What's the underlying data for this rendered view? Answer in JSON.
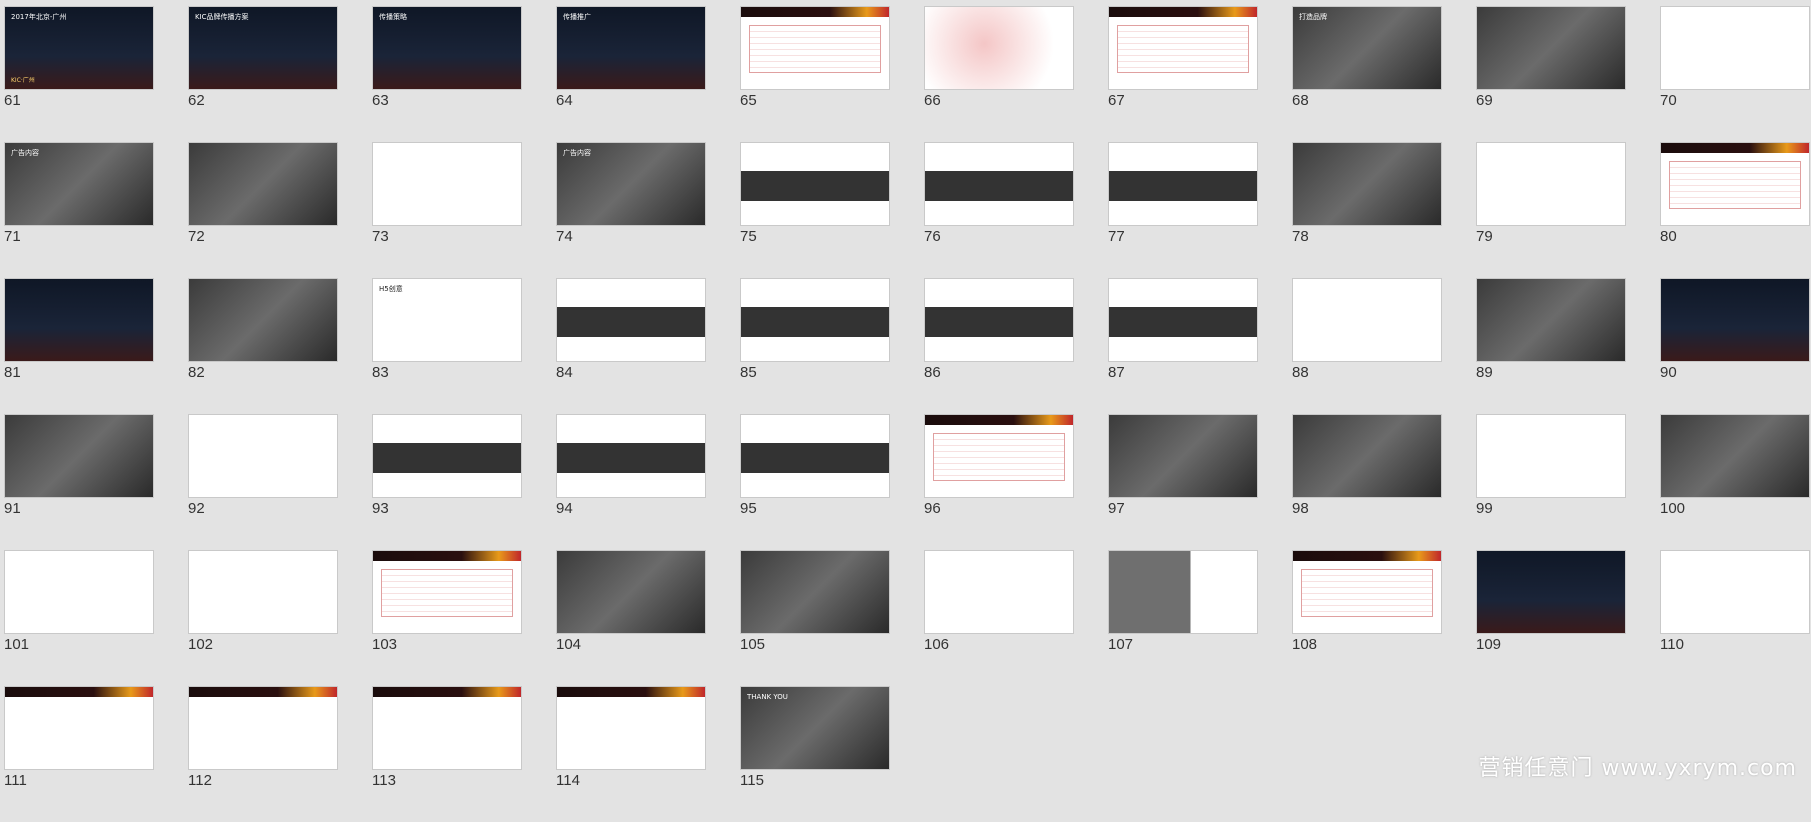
{
  "watermark": "营销任意门 www.yxrym.com",
  "slides": [
    {
      "n": "61",
      "style": "dark",
      "title": "2017年北京-广州",
      "sub": "KIC·广州"
    },
    {
      "n": "62",
      "style": "dark",
      "title": "KIC品牌传播方案",
      "sub": ""
    },
    {
      "n": "63",
      "style": "dark",
      "title": "传播策略",
      "sub": ""
    },
    {
      "n": "64",
      "style": "dark",
      "title": "传播推广",
      "sub": ""
    },
    {
      "n": "65",
      "style": "table",
      "title": "",
      "sub": ""
    },
    {
      "n": "66",
      "style": "map",
      "title": "",
      "sub": ""
    },
    {
      "n": "67",
      "style": "table",
      "title": "",
      "sub": ""
    },
    {
      "n": "68",
      "style": "photo",
      "title": "打造品牌",
      "sub": ""
    },
    {
      "n": "69",
      "style": "photo",
      "title": "",
      "sub": ""
    },
    {
      "n": "70",
      "style": "white",
      "title": "",
      "sub": ""
    },
    {
      "n": "71",
      "style": "photo",
      "title": "广告内容",
      "sub": ""
    },
    {
      "n": "72",
      "style": "photo",
      "title": "",
      "sub": ""
    },
    {
      "n": "73",
      "style": "white",
      "title": "",
      "sub": ""
    },
    {
      "n": "74",
      "style": "photo",
      "title": "广告内容",
      "sub": ""
    },
    {
      "n": "75",
      "style": "panel",
      "title": "",
      "sub": ""
    },
    {
      "n": "76",
      "style": "panel",
      "title": "",
      "sub": ""
    },
    {
      "n": "77",
      "style": "panel",
      "title": "",
      "sub": ""
    },
    {
      "n": "78",
      "style": "photo",
      "title": "",
      "sub": ""
    },
    {
      "n": "79",
      "style": "white",
      "title": "",
      "sub": ""
    },
    {
      "n": "80",
      "style": "table",
      "title": "",
      "sub": ""
    },
    {
      "n": "81",
      "style": "dark",
      "title": "",
      "sub": ""
    },
    {
      "n": "82",
      "style": "photo",
      "title": "",
      "sub": ""
    },
    {
      "n": "83",
      "style": "white",
      "title": "H5创意",
      "sub": ""
    },
    {
      "n": "84",
      "style": "panel",
      "title": "",
      "sub": ""
    },
    {
      "n": "85",
      "style": "panel",
      "title": "",
      "sub": ""
    },
    {
      "n": "86",
      "style": "panel",
      "title": "",
      "sub": ""
    },
    {
      "n": "87",
      "style": "panel",
      "title": "",
      "sub": ""
    },
    {
      "n": "88",
      "style": "white",
      "title": "",
      "sub": ""
    },
    {
      "n": "89",
      "style": "photo",
      "title": "",
      "sub": ""
    },
    {
      "n": "90",
      "style": "dark",
      "title": "",
      "sub": ""
    },
    {
      "n": "91",
      "style": "photo",
      "title": "",
      "sub": ""
    },
    {
      "n": "92",
      "style": "white",
      "title": "",
      "sub": ""
    },
    {
      "n": "93",
      "style": "panel",
      "title": "",
      "sub": ""
    },
    {
      "n": "94",
      "style": "panel",
      "title": "",
      "sub": ""
    },
    {
      "n": "95",
      "style": "panel",
      "title": "",
      "sub": ""
    },
    {
      "n": "96",
      "style": "table",
      "title": "",
      "sub": ""
    },
    {
      "n": "97",
      "style": "photo",
      "title": "",
      "sub": ""
    },
    {
      "n": "98",
      "style": "photo",
      "title": "",
      "sub": ""
    },
    {
      "n": "99",
      "style": "white",
      "title": "",
      "sub": ""
    },
    {
      "n": "100",
      "style": "photo",
      "title": "",
      "sub": ""
    },
    {
      "n": "101",
      "style": "white",
      "title": "",
      "sub": ""
    },
    {
      "n": "102",
      "style": "white",
      "title": "",
      "sub": ""
    },
    {
      "n": "103",
      "style": "table",
      "title": "",
      "sub": ""
    },
    {
      "n": "104",
      "style": "photo",
      "title": "",
      "sub": ""
    },
    {
      "n": "105",
      "style": "photo",
      "title": "",
      "sub": ""
    },
    {
      "n": "106",
      "style": "white",
      "title": "",
      "sub": ""
    },
    {
      "n": "107",
      "style": "gray",
      "title": "",
      "sub": ""
    },
    {
      "n": "108",
      "style": "table",
      "title": "",
      "sub": ""
    },
    {
      "n": "109",
      "style": "dark",
      "title": "",
      "sub": ""
    },
    {
      "n": "110",
      "style": "white",
      "title": "",
      "sub": ""
    },
    {
      "n": "111",
      "style": "bar",
      "title": "",
      "sub": ""
    },
    {
      "n": "112",
      "style": "bar",
      "title": "",
      "sub": ""
    },
    {
      "n": "113",
      "style": "bar",
      "title": "",
      "sub": ""
    },
    {
      "n": "114",
      "style": "bar",
      "title": "",
      "sub": ""
    },
    {
      "n": "115",
      "style": "photo",
      "title": "THANK YOU",
      "sub": ""
    }
  ],
  "colors": {
    "dark": "#101a2c",
    "accent": "#c0262b",
    "orange": "#e89a1a",
    "panel": "#333333"
  }
}
